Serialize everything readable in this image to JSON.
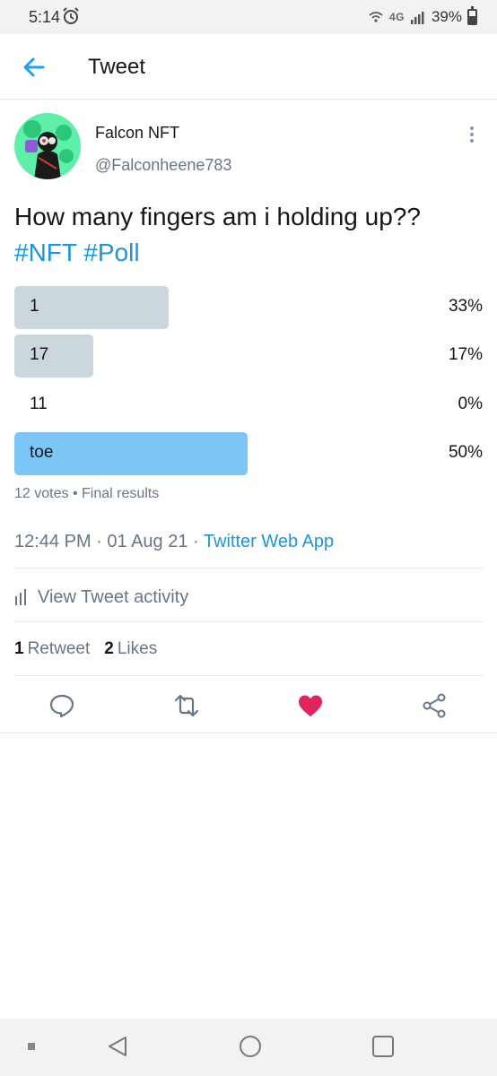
{
  "status_bar": {
    "time": "5:14",
    "network": "4G",
    "battery": "39%"
  },
  "header": {
    "title": "Tweet"
  },
  "author": {
    "display_name": "Falcon NFT",
    "username": "@Falconheene783"
  },
  "tweet": {
    "text": "How many fingers am i holding up??",
    "hashtags": [
      "#NFT",
      "#Poll"
    ]
  },
  "poll": {
    "options": [
      {
        "label": "1",
        "percent": "33%",
        "share": 0.33,
        "color": "#ccd6dd"
      },
      {
        "label": "17",
        "percent": "17%",
        "share": 0.17,
        "color": "#ccd6dd"
      },
      {
        "label": "11",
        "percent": "0%",
        "share": 0,
        "color": "#ccd6dd"
      },
      {
        "label": "toe",
        "percent": "50%",
        "share": 0.5,
        "color": "#7bc6f6"
      }
    ],
    "votes": "12 votes",
    "status": "Final results"
  },
  "meta": {
    "time": "12:44 PM",
    "date": "01 Aug 21",
    "source": "Twitter Web App"
  },
  "activity": {
    "label": "View Tweet activity"
  },
  "stats": {
    "retweets_count": "1",
    "retweets_label": "Retweet",
    "likes_count": "2",
    "likes_label": "Likes"
  },
  "colors": {
    "accent": "#1da1f2",
    "liked": "#e0245e",
    "muted": "#657786"
  },
  "icons": {
    "back": "arrow-left-icon",
    "more": "more-vertical-icon",
    "reply": "reply-icon",
    "retweet": "retweet-icon",
    "like": "heart-icon",
    "share": "share-icon",
    "activity": "bar-chart-icon"
  }
}
